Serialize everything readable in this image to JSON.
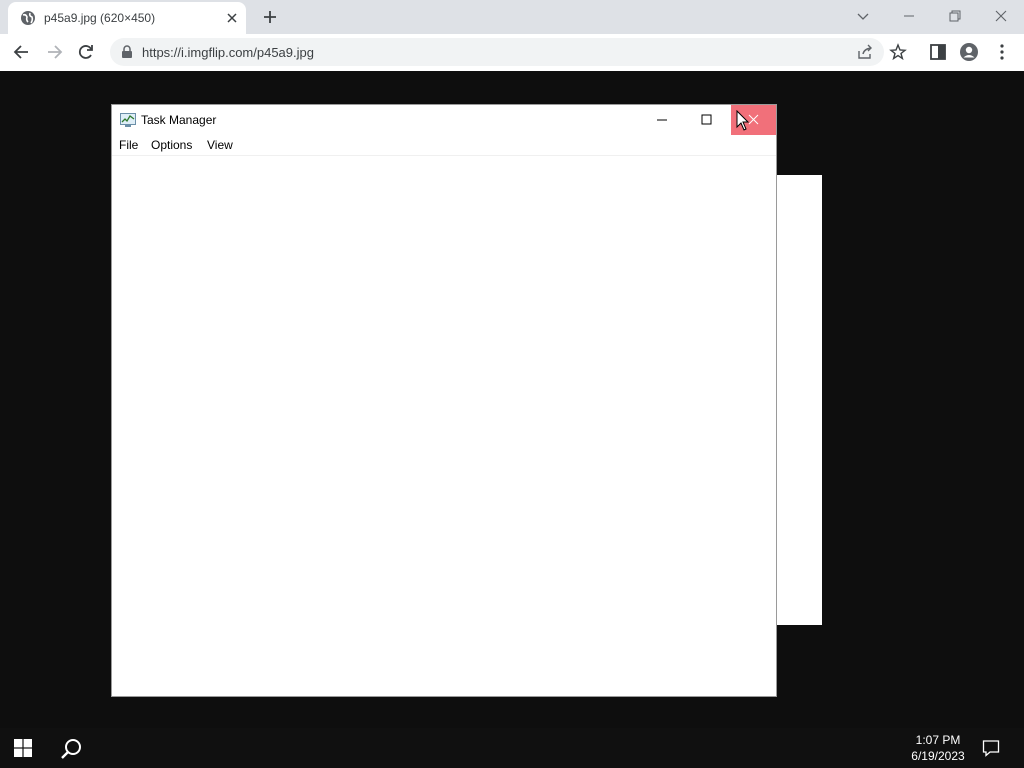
{
  "browser": {
    "tab": {
      "title": "p45a9.jpg (620×450)",
      "favicon": "globe-icon"
    },
    "address_bar": {
      "url": "https://i.imgflip.com/p45a9.jpg",
      "secure": true
    },
    "icons": {
      "back": "arrow-left-icon",
      "forward": "arrow-right-icon",
      "reload": "reload-icon",
      "share": "share-icon",
      "bookmark": "star-icon",
      "side_panel": "side-panel-icon",
      "profile": "profile-icon",
      "menu": "kebab-menu-icon"
    }
  },
  "task_manager": {
    "title": "Task Manager",
    "menu": [
      "File",
      "Options",
      "View"
    ],
    "close_button_color": "#f1707a"
  },
  "taskbar": {
    "time": "1:07 PM",
    "date": "6/19/2023"
  }
}
